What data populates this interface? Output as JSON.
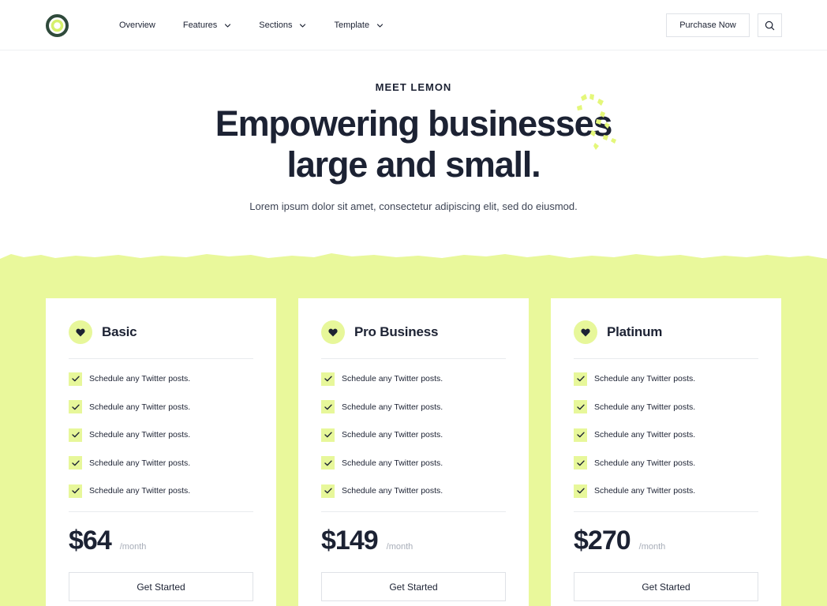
{
  "header": {
    "nav": [
      {
        "label": "Overview",
        "has_dropdown": false
      },
      {
        "label": "Features",
        "has_dropdown": true
      },
      {
        "label": "Sections",
        "has_dropdown": true
      },
      {
        "label": "Template",
        "has_dropdown": true
      }
    ],
    "purchase_label": "Purchase Now",
    "search_icon": "search-icon"
  },
  "hero": {
    "eyebrow": "MEET LEMON",
    "title_line1": "Empowering businesses",
    "title_line2": "large and small.",
    "subtitle": "Lorem ipsum dolor sit amet, consectetur adipiscing elit, sed do eiusmod."
  },
  "colors": {
    "accent": "#e9f89b",
    "text": "#1c2233",
    "logo_ring": "#2f4a3b",
    "logo_center": "#d6f06b"
  },
  "pricing": {
    "plans": [
      {
        "name": "Basic",
        "icon": "heart-icon",
        "features": [
          "Schedule any Twitter posts.",
          "Schedule any Twitter posts.",
          "Schedule any Twitter posts.",
          "Schedule any Twitter posts.",
          "Schedule any Twitter posts."
        ],
        "price": "$64",
        "period": "/month",
        "cta": "Get Started"
      },
      {
        "name": "Pro Business",
        "icon": "heart-icon",
        "features": [
          "Schedule any Twitter posts.",
          "Schedule any Twitter posts.",
          "Schedule any Twitter posts.",
          "Schedule any Twitter posts.",
          "Schedule any Twitter posts."
        ],
        "price": "$149",
        "period": "/month",
        "cta": "Get Started"
      },
      {
        "name": "Platinum",
        "icon": "heart-icon",
        "features": [
          "Schedule any Twitter posts.",
          "Schedule any Twitter posts.",
          "Schedule any Twitter posts.",
          "Schedule any Twitter posts.",
          "Schedule any Twitter posts."
        ],
        "price": "$270",
        "period": "/month",
        "cta": "Get Started"
      }
    ]
  }
}
